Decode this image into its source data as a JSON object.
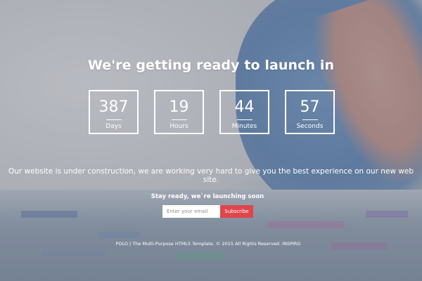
{
  "headline": "We're getting ready to launch in",
  "countdown": [
    {
      "value": "387",
      "label": "Days"
    },
    {
      "value": "19",
      "label": "Hours"
    },
    {
      "value": "44",
      "label": "Minutes"
    },
    {
      "value": "57",
      "label": "Seconds"
    }
  ],
  "message": "Our website is under construction, we are working very hard to give you the best experience on our new web site.",
  "subscribe": {
    "title": "Stay ready, we`re launching soon",
    "email_placeholder": "Enter your email",
    "button_label": "Subscribe",
    "button_color": "#e0454b"
  },
  "footer": "POLO | The Multi-Purpose HTML5 Template. © 2015 All Rights Reserved. INSPIRO"
}
